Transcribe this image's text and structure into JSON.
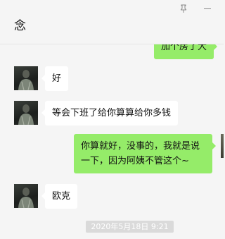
{
  "header": {
    "title": "念"
  },
  "messages": [
    {
      "side": "right",
      "text": "加个房了大"
    },
    {
      "side": "left",
      "text": "好"
    },
    {
      "side": "left",
      "text": "等会下班了给你算算给你多钱"
    },
    {
      "side": "right",
      "text": "你算就好，没事的，我就是说一下，因为阿姨不管这个~"
    },
    {
      "side": "left",
      "text": "欧克"
    }
  ],
  "timestamp": "2020年5月18日 9:21",
  "colors": {
    "outgoing_bubble": "#95ec69",
    "incoming_bubble": "#ffffff",
    "background": "#f5f5f5"
  }
}
